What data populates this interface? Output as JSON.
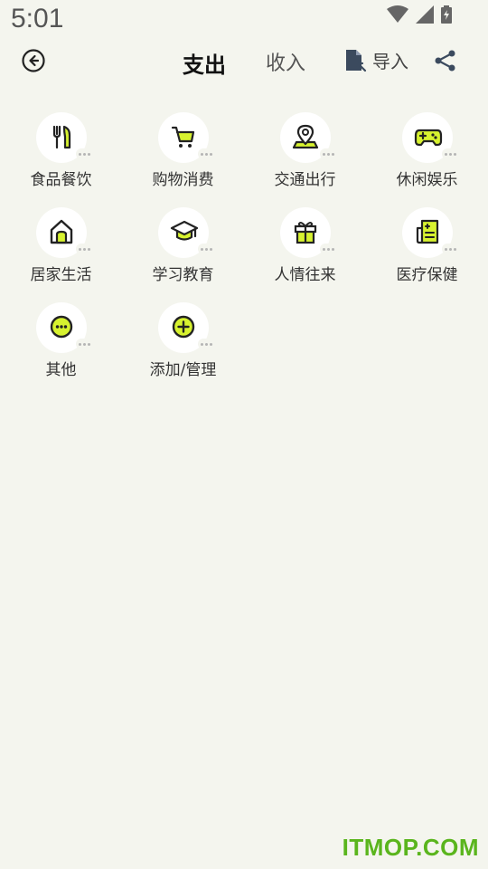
{
  "status_bar": {
    "time": "5:01"
  },
  "header": {
    "tabs": [
      {
        "label": "支出",
        "active": true
      },
      {
        "label": "收入",
        "active": false
      }
    ],
    "import_label": "导入"
  },
  "categories": [
    {
      "label": "食品餐饮",
      "icon": "fork-knife-icon"
    },
    {
      "label": "购物消费",
      "icon": "shopping-cart-icon"
    },
    {
      "label": "交通出行",
      "icon": "location-pin-icon"
    },
    {
      "label": "休闲娱乐",
      "icon": "gamepad-icon"
    },
    {
      "label": "居家生活",
      "icon": "house-icon"
    },
    {
      "label": "学习教育",
      "icon": "graduation-cap-icon"
    },
    {
      "label": "人情往来",
      "icon": "gift-icon"
    },
    {
      "label": "医疗保健",
      "icon": "medical-record-icon"
    },
    {
      "label": "其他",
      "icon": "more-circle-icon"
    },
    {
      "label": "添加/管理",
      "icon": "add-circle-icon"
    }
  ],
  "colors": {
    "accent": "#d7f22f",
    "background": "#f4f5ee",
    "watermark": "#5ab51d"
  },
  "watermark": "ITMOP.COM"
}
